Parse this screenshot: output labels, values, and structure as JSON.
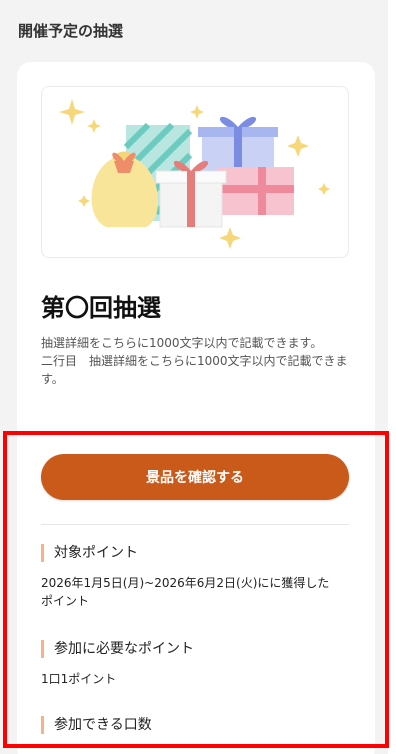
{
  "section": {
    "title": "開催予定の抽選"
  },
  "lottery": {
    "title": "第〇回抽選",
    "description": [
      "抽選詳細をこちらに1000文字以内で記載できます。",
      "二行目　抽選詳細をこちらに1000文字以内で記載できます。"
    ],
    "cta_label": "景品を確認する",
    "cta_color": "#c95a1a",
    "accent_color": "#f2b48c"
  },
  "info": {
    "target_points": {
      "heading": "対象ポイント",
      "value": "2026年1月5日(月)~2026年6月2日(火)にに獲得したポイント"
    },
    "required_points": {
      "heading": "参加に必要なポイント",
      "value": "1口1ポイント"
    },
    "entries": {
      "heading": "参加できる口数"
    }
  },
  "illustration": {
    "icon": "gift-boxes-illustration"
  }
}
